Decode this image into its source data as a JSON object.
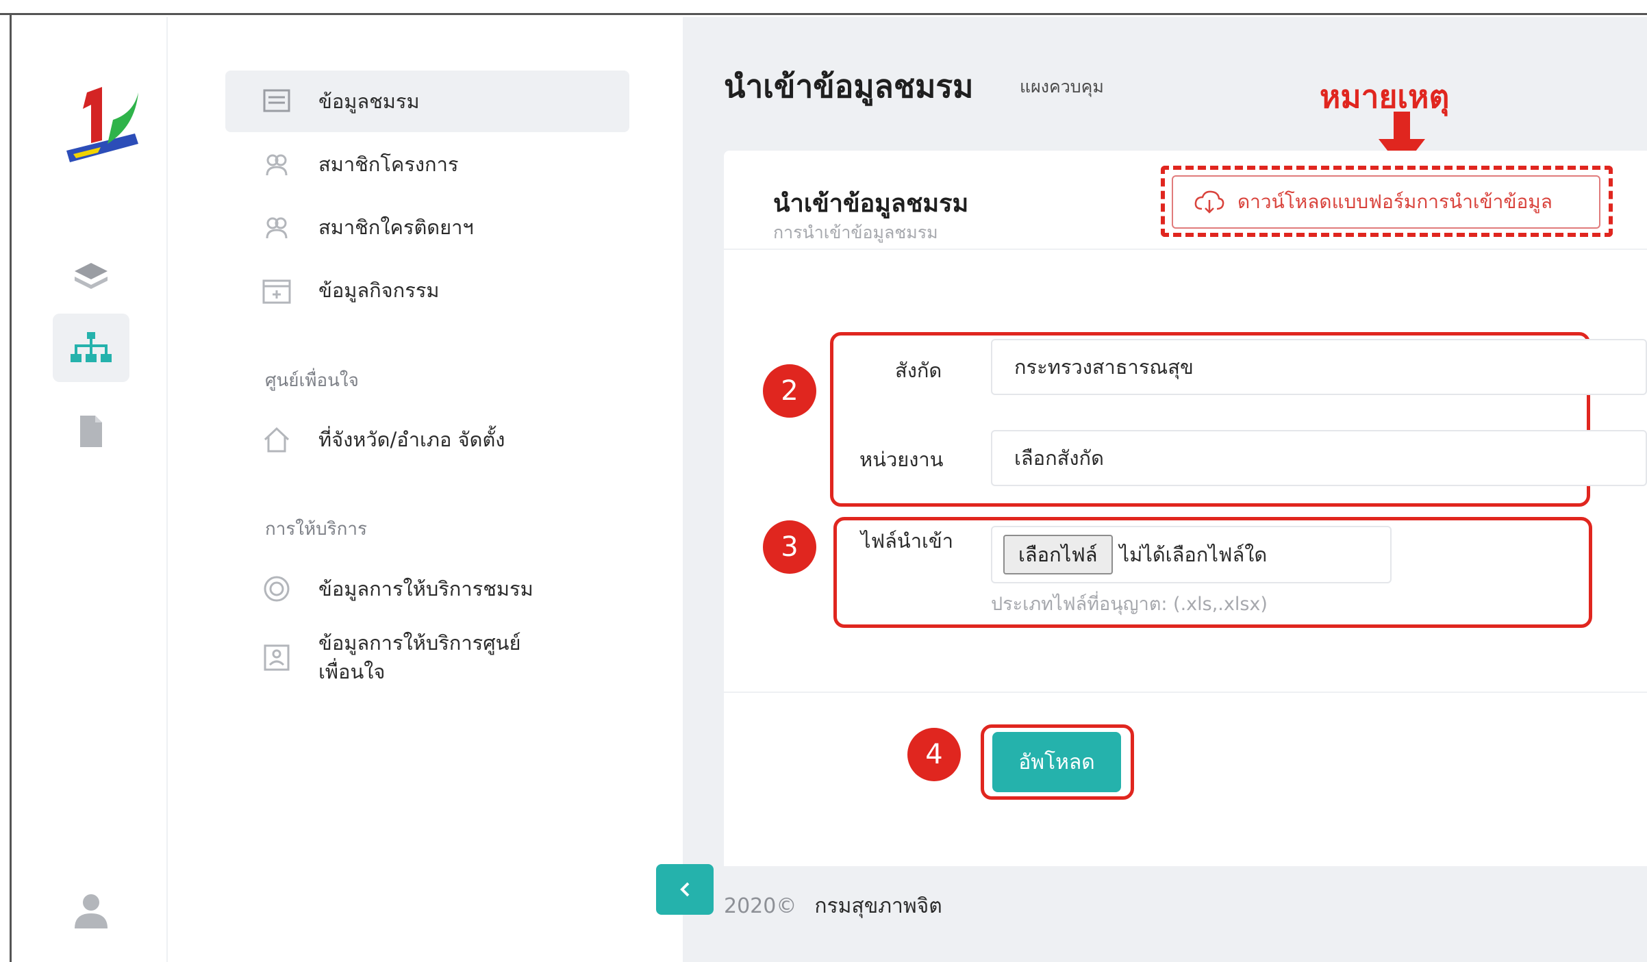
{
  "sidebar": {
    "rail_icons": [
      "layers-icon",
      "sitemap-icon",
      "document-icon",
      "user-icon"
    ],
    "items": [
      {
        "label": "ข้อมูลชมรม",
        "icon": "club-icon"
      },
      {
        "label": "สมาชิกโครงการ",
        "icon": "members-icon"
      },
      {
        "label": "สมาชิกใครติดยาฯ",
        "icon": "members-icon"
      },
      {
        "label": "ข้อมูลกิจกรรม",
        "icon": "calendar-icon"
      }
    ],
    "section_center": "ศูนย์เพื่อนใจ",
    "center_items": [
      {
        "label": "ที่จังหวัด/อำเภอ จัดตั้ง",
        "icon": "home-icon"
      }
    ],
    "section_service": "การให้บริการ",
    "service_items": [
      {
        "label": "ข้อมูลการให้บริการชมรม",
        "icon": "service-icon"
      },
      {
        "label_line1": "ข้อมูลการให้บริการศูนย์",
        "label_line2": "เพื่อนใจ",
        "icon": "badge-icon"
      }
    ]
  },
  "header": {
    "title": "นำเข้าข้อมูลชมรม",
    "subtitle": "แผงควบคุม",
    "note": "หมายเหตุ"
  },
  "card": {
    "title": "นำเข้าข้อมูลชมรม",
    "subtitle": "การนำเข้าข้อมูลชมรม",
    "download_label": "ดาวน์โหลดแบบฟอร์มการนำเข้าข้อมูล"
  },
  "form": {
    "affiliation_label": "สังกัด",
    "affiliation_value": "กระทรวงสาธารณสุข",
    "unit_label": "หน่วยงาน",
    "unit_value": "เลือกสังกัด",
    "file_label": "ไฟล์นำเข้า",
    "choose_file_label": "เลือกไฟล์",
    "no_file_text": "ไม่ได้เลือกไฟล์ใด",
    "file_hint": "ประเภทไฟล์ที่อนุญาต: (.xls,.xlsx)",
    "upload_label": "อัพโหลด"
  },
  "badges": [
    "2",
    "3",
    "4"
  ],
  "footer": {
    "year": "2020©",
    "org": "กรมสุขภาพจิต"
  },
  "colors": {
    "accent": "#25b2ac",
    "annotation": "#e0261f",
    "background": "#eef0f3"
  }
}
